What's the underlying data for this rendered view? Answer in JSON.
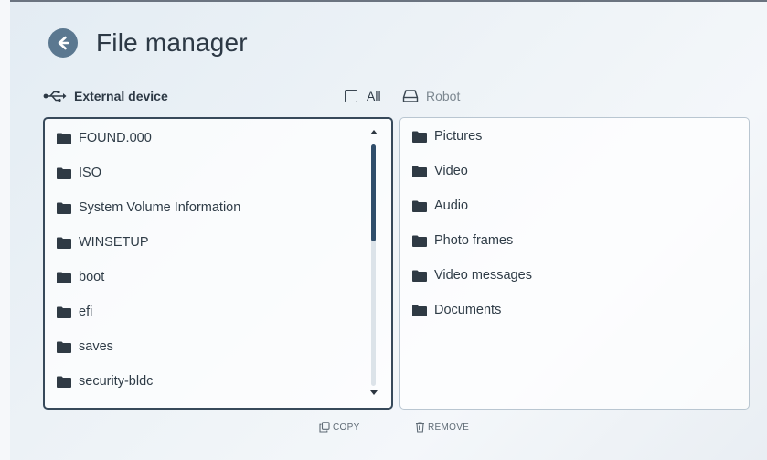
{
  "header": {
    "title": "File manager"
  },
  "source": {
    "label": "External device",
    "icon": "usb-icon"
  },
  "select_all": {
    "label": "All",
    "checked": false
  },
  "destination": {
    "label": "Robot",
    "icon": "robot-storage-icon"
  },
  "left_panel": {
    "items": [
      "FOUND.000",
      "ISO",
      "System Volume Information",
      "WINSETUP",
      "boot",
      "efi",
      "saves",
      "security-bldc"
    ]
  },
  "right_panel": {
    "items": [
      "Pictures",
      "Video",
      "Audio",
      "Photo frames",
      "Video messages",
      "Documents"
    ]
  },
  "actions": {
    "copy_label": "COPY",
    "remove_label": "REMOVE"
  },
  "colors": {
    "accent": "#5b7890",
    "selection_border": "#37495a",
    "scroll_thumb": "#2f4d6a"
  }
}
